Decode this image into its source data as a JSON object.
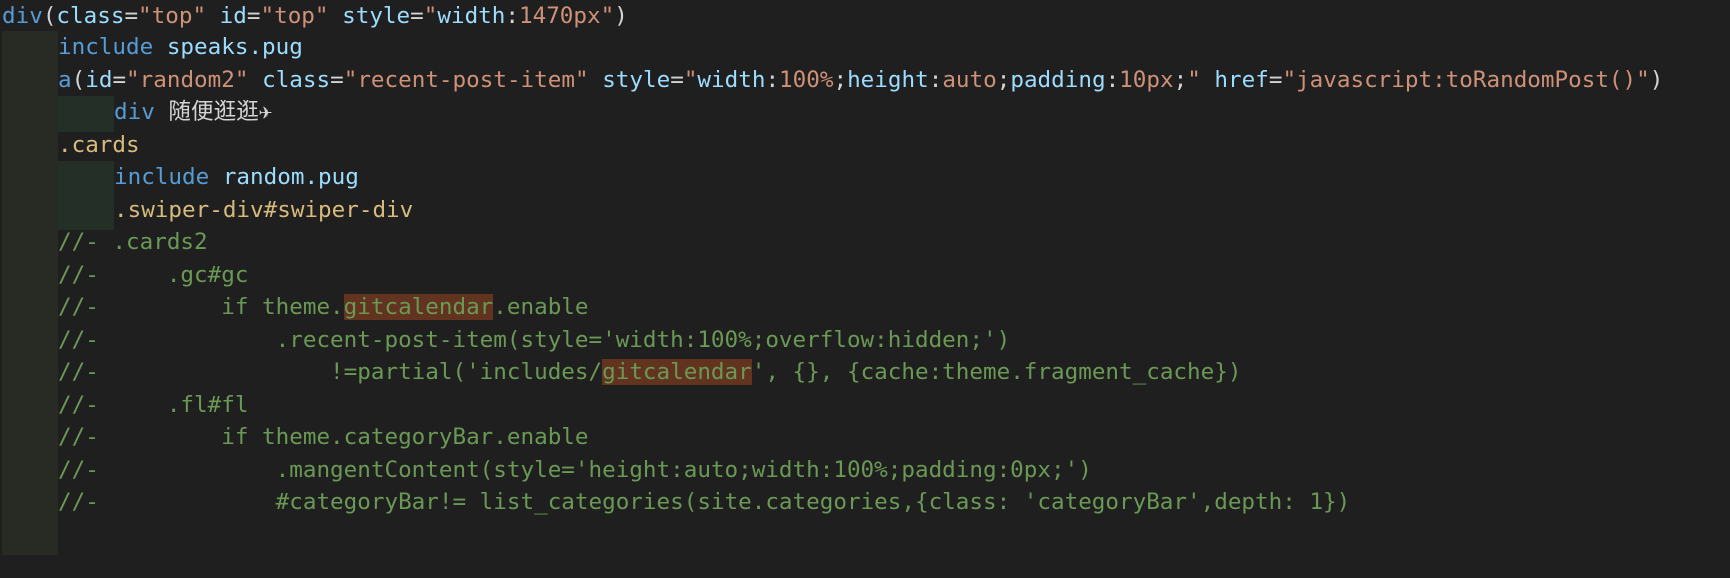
{
  "lines": [
    "div(class=\"top\" id=\"top\" style=\"width:1470px\")",
    "include speaks.pug",
    "a(id=\"random2\" class=\"recent-post-item\" style=\"width:100%;height:auto;padding:10px;\" href=\"javascript:toRandomPost()\")",
    "div 随便逛逛✈",
    ".cards",
    "include random.pug",
    ".swiper-div#swiper-div",
    "//- .cards2",
    "//-     .gc#gc",
    "//-         if theme.gitcalendar.enable",
    "//-             .recent-post-item(style='width:100%;overflow:hidden;')",
    "//-                 !=partial('includes/gitcalendar', {}, {cache:theme.fragment_cache})",
    "//-     .fl#fl",
    "//-         if theme.categoryBar.enable",
    "//-             .mangentContent(style='height:auto;width:100%;padding:0px;')",
    "//-             #categoryBar!= list_categories(site.categories,{class: 'categoryBar',depth: 1})"
  ],
  "tokens": {
    "l0": {
      "tag": "div",
      "p_open": "(",
      "a_class": "class",
      "eq": "=",
      "v_class": "\"top\"",
      "a_id": "id",
      "v_id": "\"top\"",
      "a_style": "style",
      "v_style_q1": "\"",
      "v_style_key": "width",
      "colon": ":",
      "v_style_val": "1470px",
      "v_style_q2": "\"",
      "p_close": ")"
    },
    "l1": {
      "kw": "include",
      "path": "speaks.pug"
    },
    "l2": {
      "tag": "a",
      "p_open": "(",
      "a_id": "id",
      "eq": "=",
      "v_id": "\"random2\"",
      "a_class": "class",
      "v_class": "\"recent-post-item\"",
      "a_style": "style",
      "q": "\"",
      "k1": "width",
      "colon": ":",
      "v1": "100%",
      "semi": ";",
      "k2": "height",
      "v2": "auto",
      "k3": "padding",
      "v3": "10px",
      "a_href": "href",
      "v_href": "\"javascript:toRandomPost()\"",
      "p_close": ")"
    },
    "l3": {
      "tag": "div",
      "text": "随便逛逛✈"
    },
    "l4": {
      "cls": ".cards"
    },
    "l5": {
      "kw": "include",
      "path": "random.pug"
    },
    "l6": {
      "cls": ".swiper-div#swiper-div"
    },
    "l7": {
      "cmt": "//- .cards2"
    },
    "l8": {
      "cmt": "//-     .gc#gc"
    },
    "l9": {
      "pre": "//-         if theme.",
      "hl": "gitcalendar",
      "post": ".enable"
    },
    "l10": {
      "cmt": "//-             .recent-post-item(style='width:100%;overflow:hidden;')"
    },
    "l11": {
      "pre": "//-                 !=partial('includes/",
      "hl": "gitcalendar",
      "post": "', {}, {cache:theme.fragment_cache})"
    },
    "l12": {
      "cmt": "//-     .fl#fl"
    },
    "l13": {
      "cmt": "//-         if theme.categoryBar.enable"
    },
    "l14": {
      "cmt": "//-             .mangentContent(style='height:auto;width:100%;padding:0px;')"
    },
    "l15": {
      "cmt": "//-             #categoryBar!= list_categories(site.categories,{class: 'categoryBar',depth: 1})"
    }
  },
  "colors": {
    "background": "#1f1f1f",
    "tag": "#569cd6",
    "attribute": "#9cdcfe",
    "string": "#ce9178",
    "class_selector": "#d7ba7d",
    "comment": "#6a9955",
    "text": "#d4d4d4",
    "find_highlight": "#62331f",
    "indent_guide_1": "#282a24",
    "indent_guide_2": "#232f27"
  }
}
